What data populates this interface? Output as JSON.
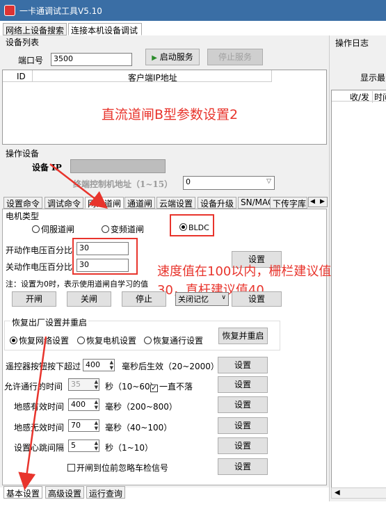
{
  "window": {
    "title": "一卡通调试工具V5.10"
  },
  "top_tabs": [
    "网络上设备搜索",
    "连接本机设备调试"
  ],
  "device_list": {
    "section_label": "设备列表",
    "port_label": "端口号",
    "port_value": "3500",
    "start_button": "启动服务",
    "stop_button": "停止服务",
    "columns": [
      "ID",
      "客户端IP地址"
    ]
  },
  "overlay_titles": {
    "main": "直流道闸B型参数设置2",
    "speed_note_line1": "速度值在100以内，栅栏建议值",
    "speed_note_line2": "30，直杆建议值40"
  },
  "log_panel": {
    "label": "操作日志",
    "display_label": "显示最",
    "columns": [
      "收/发",
      "时间"
    ]
  },
  "operate_device": {
    "section_label": "操作设备",
    "device_ip_label": "设备 IP",
    "terminal_addr_label": "终端控制机地址（1~15）",
    "terminal_addr_value": "0"
  },
  "sub_tabs": [
    "设置命令",
    "调试命令",
    "网口道闸",
    "通道闸",
    "云端设置",
    "设备升级",
    "SN/MAC",
    "下传字库"
  ],
  "motor": {
    "section_label": "电机类型",
    "options": [
      "伺服道闸",
      "变频道闸",
      "BLDC"
    ]
  },
  "voltage": {
    "open_label": "开动作电压百分比",
    "open_value": "30",
    "close_label": "关动作电压百分比",
    "close_value": "30",
    "set_button": "设置",
    "note": "注：设置为0时，表示使用道闸自学习的值",
    "buttons": [
      "开闸",
      "关闸",
      "停止"
    ],
    "memory_select": "关闭记忆",
    "memory_set_button": "设置"
  },
  "factory": {
    "section_label": "恢复出厂设置并重启",
    "options": [
      "恢复网络设置",
      "恢复电机设置",
      "恢复通行设置"
    ],
    "restart_button": "恢复并重启"
  },
  "params": {
    "remote_label": "遥控器按钮按下超过",
    "remote_value": "400",
    "remote_unit": "毫秒后生效（20~2000）",
    "pass_label": "允许通行的时间",
    "pass_value": "35",
    "pass_unit": "秒（10~60）",
    "always_open": "一直不落",
    "loop_valid_label": "地感有效时间",
    "loop_valid_value": "400",
    "loop_valid_unit": "毫秒（200~800）",
    "loop_invalid_label": "地感无效时间",
    "loop_invalid_value": "70",
    "loop_invalid_unit": "毫秒（40~100）",
    "heartbeat_label": "设置心跳间隔",
    "heartbeat_value": "5",
    "heartbeat_unit": "秒（1~10）",
    "ignore_label": "开闸到位前忽略车检信号",
    "set_button": "设置"
  },
  "bottom_tabs": [
    "基本设置",
    "高级设置",
    "运行查询"
  ]
}
